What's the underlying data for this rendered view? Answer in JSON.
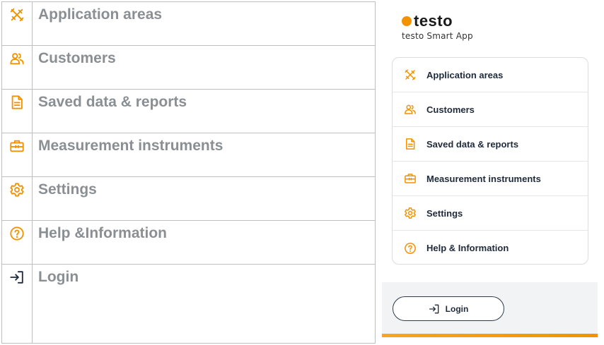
{
  "colors": {
    "accent": "#f39200",
    "doc_label": "#8a8f94",
    "menu_text": "#1f2a3a",
    "border": "#bfbfbf"
  },
  "doc_table": {
    "rows": [
      {
        "icon": "application-areas-icon",
        "label": "Application areas"
      },
      {
        "icon": "customers-icon",
        "label": "Customers"
      },
      {
        "icon": "saved-data-icon",
        "label": "Saved data & reports"
      },
      {
        "icon": "measurement-instruments-icon",
        "label": "Measurement instruments"
      },
      {
        "icon": "settings-icon",
        "label": "Settings"
      },
      {
        "icon": "help-icon",
        "label": "Help &Information"
      },
      {
        "icon": "login-icon",
        "label": "Login"
      }
    ]
  },
  "app": {
    "brand": {
      "name": "testo",
      "subtitle": "testo Smart App"
    },
    "menu": [
      {
        "icon": "application-areas-icon",
        "label": "Application areas"
      },
      {
        "icon": "customers-icon",
        "label": "Customers"
      },
      {
        "icon": "saved-data-icon",
        "label": "Saved data & reports"
      },
      {
        "icon": "measurement-instruments-icon",
        "label": "Measurement instruments"
      },
      {
        "icon": "settings-icon",
        "label": "Settings"
      },
      {
        "icon": "help-icon",
        "label": "Help & Information"
      }
    ],
    "login": {
      "icon": "login-icon",
      "label": "Login"
    }
  }
}
